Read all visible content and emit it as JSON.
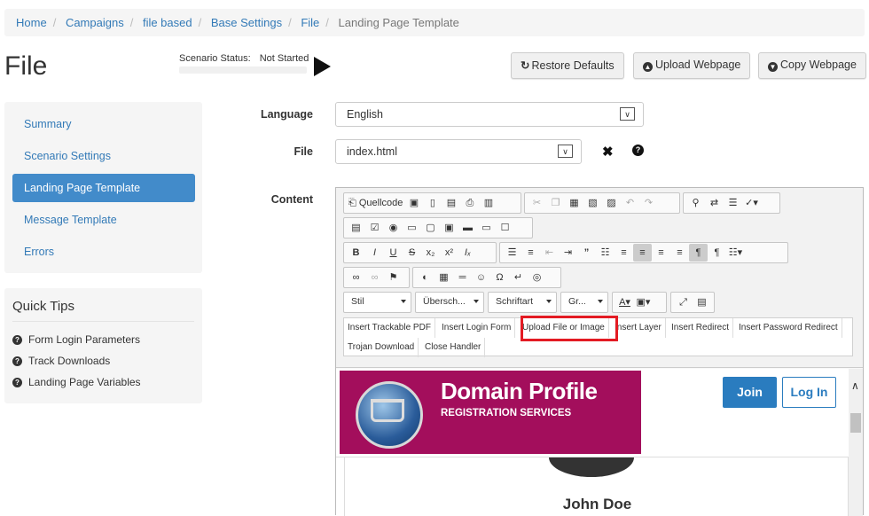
{
  "breadcrumb": {
    "items": [
      "Home",
      "Campaigns",
      "file based",
      "Base Settings",
      "File"
    ],
    "active": "Landing Page Template"
  },
  "page": {
    "title": "File"
  },
  "status": {
    "label": "Scenario Status:",
    "value": "Not Started"
  },
  "actions": {
    "restore": "Restore Defaults",
    "upload": "Upload Webpage",
    "copy": "Copy Webpage"
  },
  "sidebar": {
    "items": [
      {
        "label": "Summary"
      },
      {
        "label": "Scenario Settings"
      },
      {
        "label": "Landing Page Template"
      },
      {
        "label": "Message Template"
      },
      {
        "label": "Errors"
      }
    ]
  },
  "tips": {
    "title": "Quick Tips",
    "items": [
      {
        "label": "Form Login Parameters"
      },
      {
        "label": "Track Downloads"
      },
      {
        "label": "Landing Page Variables"
      }
    ]
  },
  "form": {
    "language_label": "Language",
    "language_value": "English",
    "file_label": "File",
    "file_value": "index.html",
    "content_label": "Content"
  },
  "editor": {
    "source_label": "Quellcode",
    "style_combo": "Stil",
    "heading_combo": "Übersch...",
    "font_combo": "Schriftart",
    "size_combo": "Gr...",
    "custom_buttons": [
      "Insert Trackable PDF",
      "Insert Login Form",
      "Upload File or Image",
      "Insert Layer",
      "Insert Redirect",
      "Insert Password Redirect",
      "Trojan Download",
      "Close Handler"
    ]
  },
  "preview": {
    "brand_title": "Domain Profile",
    "brand_subtitle": "REGISTRATION SERVICES",
    "join_label": "Join",
    "login_label": "Log In",
    "user_name": "John Doe"
  },
  "colors": {
    "primary": "#428bca",
    "link": "#337ab7",
    "banner": "#a30e5c",
    "highlight": "#e31b23"
  }
}
